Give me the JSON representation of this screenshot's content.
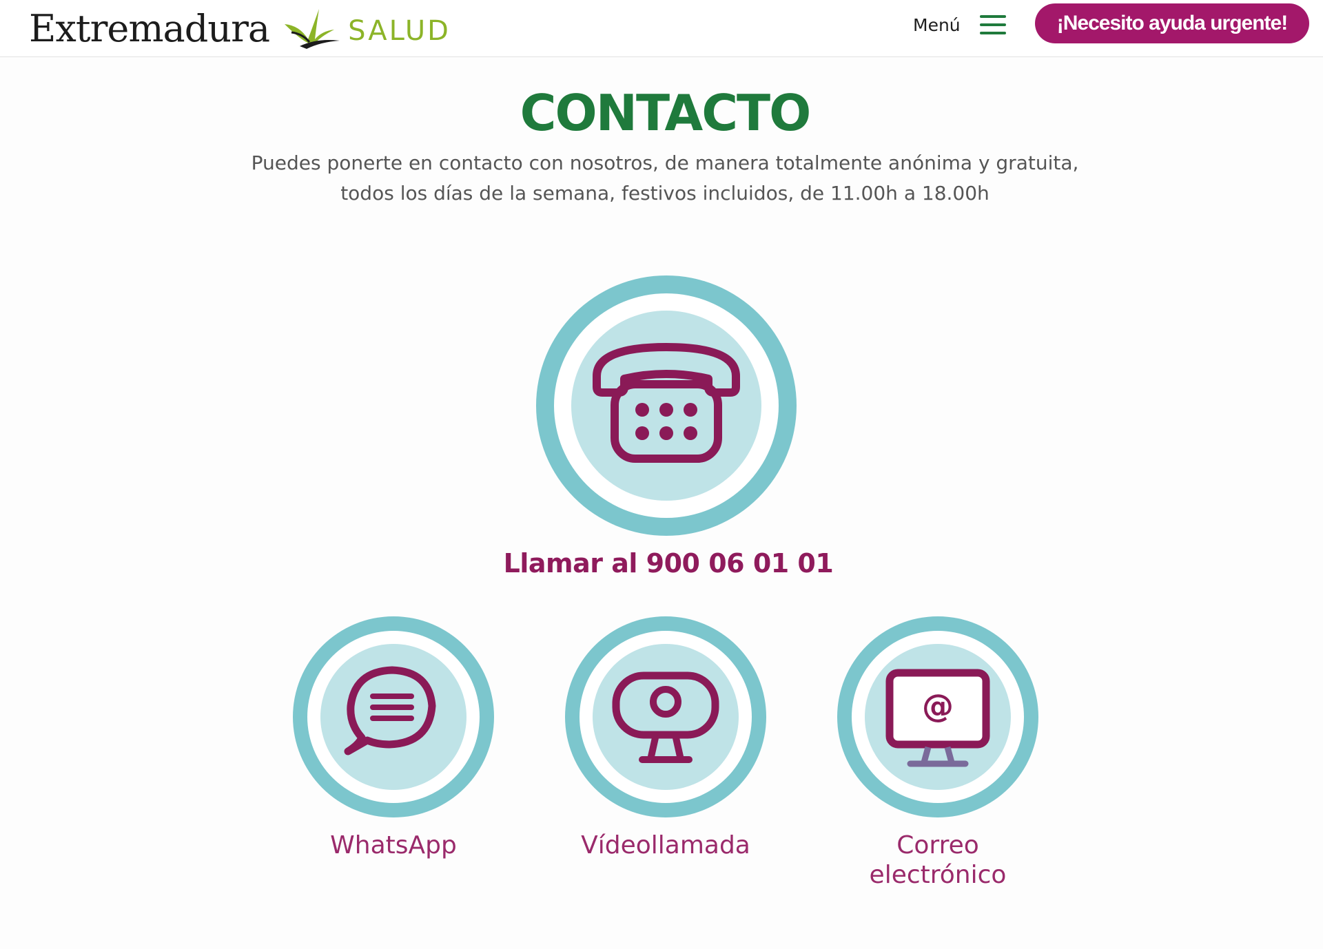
{
  "header": {
    "logo_text": "Extremadura",
    "logo_suffix": "SALUD",
    "menu_label": "Menú",
    "urgent_button": "¡Necesito ayuda urgente!"
  },
  "main": {
    "title": "CONTACTO",
    "intro_line1": "Puedes ponerte en contacto con nosotros, de manera totalmente anónima y gratuita,",
    "intro_line2": "todos los días de la semana, festivos incluidos, de 11.00h a 18.00h",
    "call_label": "Llamar al 900 06 01 01",
    "options": [
      {
        "label": "WhatsApp",
        "icon": "chat-bubble-icon"
      },
      {
        "label": "Vídeollamada",
        "icon": "webcam-icon"
      },
      {
        "label_line1": "Correo",
        "label_line2": "electrónico",
        "icon": "email-monitor-icon"
      }
    ]
  },
  "colors": {
    "brand_green": "#1f7a3c",
    "logo_green": "#8cb428",
    "magenta": "#a3186a",
    "icon_purple": "#8a1a57",
    "teal_ring": "#7cc6cd",
    "teal_fill": "#bfe3e7"
  }
}
